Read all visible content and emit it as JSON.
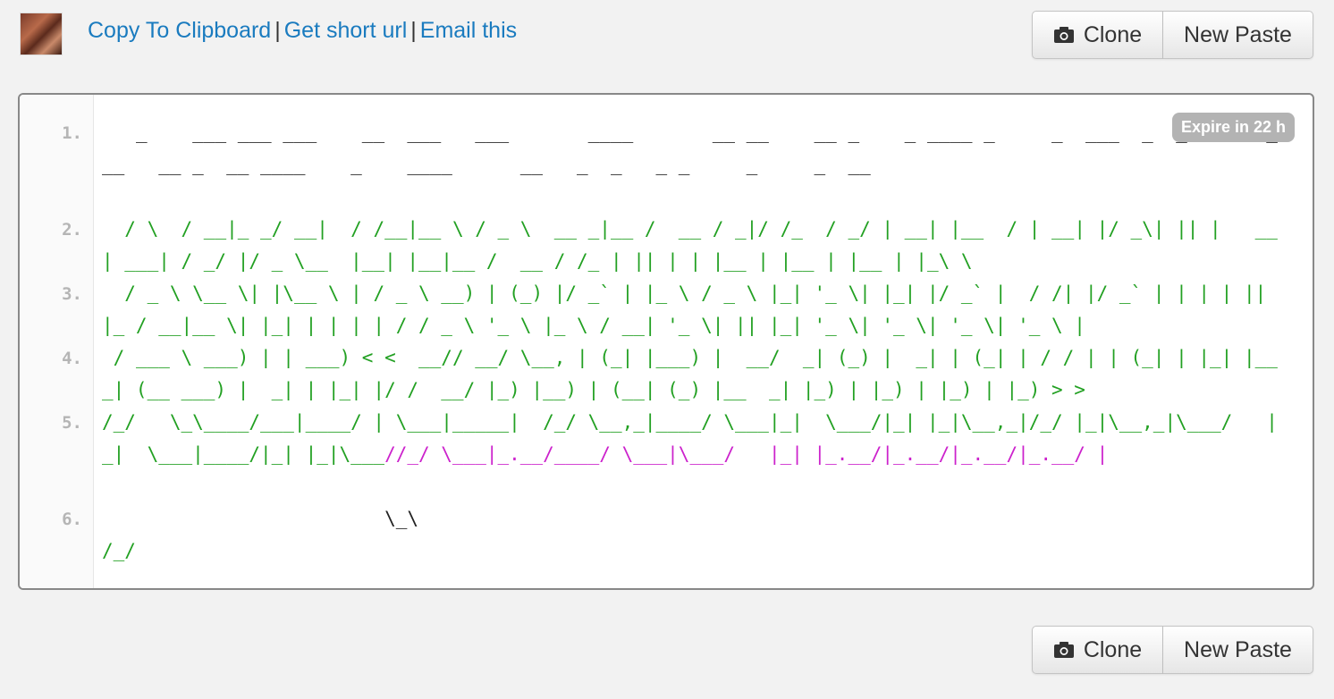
{
  "header": {
    "links": {
      "copy": "Copy To Clipboard",
      "short_url": "Get short url",
      "email": "Email this",
      "separator": "|"
    }
  },
  "buttons": {
    "clone": "Clone",
    "new_paste": "New Paste"
  },
  "icons": {
    "camera": "camera-icon"
  },
  "badge": {
    "expire": "Expire in 22 h"
  },
  "colors": {
    "link": "#1a7bbf",
    "green": "#22a022",
    "magenta": "#cc22cc"
  },
  "code": {
    "line_numbers": [
      "1.",
      "2.",
      "3.",
      "4.",
      "5.",
      "6."
    ],
    "l1": "   _    ___ ___ ___    __  ___   ___       ____       __ __    __ _    _ ____ _     _  ___  _  _       ___   __ _  __ ____    _    ____      __   _  _   _ _     _     _  __",
    "l2": "  / \\  / __|_ _/ __|  / /__|__ \\ / _ \\  __ _|__ /  __ / _|/ /_  / _/ | __| |__  / | __| |/ _\\| || |   __| ___| / _/ |/ _ \\__  |__| |__|__ /  __ / /_ | || | | |__ | |__ | |__ | |_\\ \\",
    "l3": "  / _ \\ \\__ \\| |\\__ \\ | / _ \\ __) | (_) |/ _` | |_ \\ / _ \\ |_| '_ \\| |_| |/ _` |  / /| |/ _` | | | | || |_ / __|__ \\| |_| | | | | / / _ \\ '_ \\ |_ \\ / __| '_ \\| || |_| '_ \\| '_ \\| '_ \\| '_ \\ |",
    "l4": " / ___ \\ ___) | | ___) < <  __// __/ \\__, | (_| |___) |  __/  _| (_) |  _| | (_| | / / | | (_| | |_| |__  _| (__ ___) |  _| | |_| |/ /  __/ |_) |__) | (__| (_) |__  _| |_) | |_) | |_) | |_) > >",
    "l5_green": "/_/   \\_\\____/___|____/ | \\___|_____|  /_/ \\__,_|____/ \\___|_|  \\___/|_| |_|\\__,_|/_/ |_|\\__,_|\\___/   |_|  \\___|____/|_| |_|\\___",
    "l5_magenta": "//_/ \\___|_.__/____/ \\___|\\___/   |_| |_.__/|_.__/|_.__/|_.__/ |",
    "l6": "                         \\_\\",
    "l6_green": "/_/"
  }
}
